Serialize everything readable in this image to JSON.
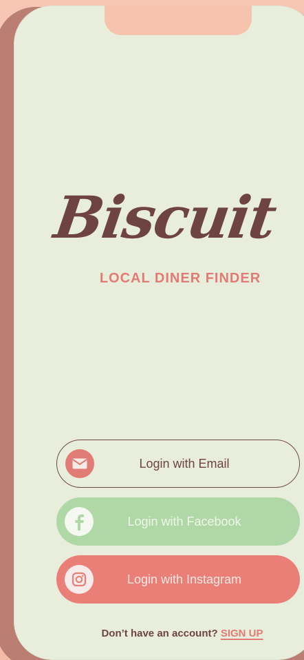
{
  "app": {
    "name": "Biscuit",
    "tagline": "LOCAL DINER FINDER"
  },
  "login": {
    "email_label": "Login with Email",
    "facebook_label": "Login with Facebook",
    "instagram_label": "Login with Instagram"
  },
  "footer": {
    "prompt": "Don’t have an account?",
    "signup_label": "SIGN UP"
  },
  "icons": {
    "email": "mail-icon",
    "facebook": "facebook-icon",
    "instagram": "instagram-icon"
  },
  "colors": {
    "brand_brown": "#6d4441",
    "accent_coral": "#e17b75",
    "facebook_green": "#b0d8a6",
    "instagram_coral": "#ea7f78",
    "screen_bg": "#e9eddc"
  }
}
